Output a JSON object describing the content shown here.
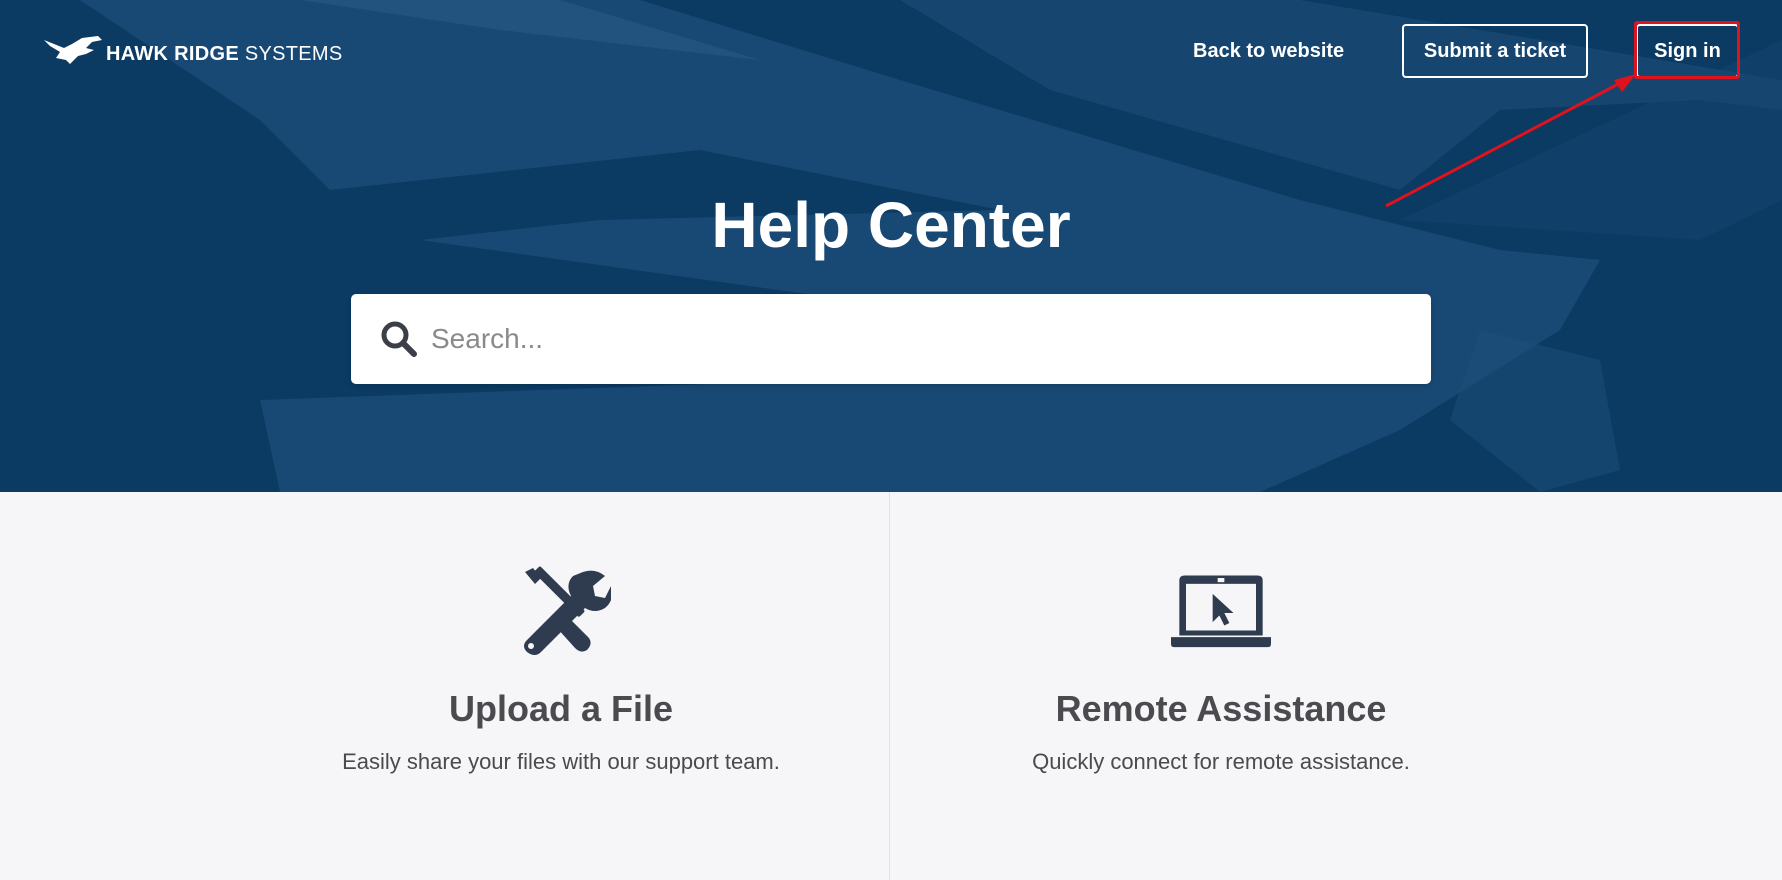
{
  "header": {
    "logo_text_bold": "HAWK RIDGE",
    "logo_text_regular": "SYSTEMS",
    "back_link": "Back to website",
    "submit_ticket": "Submit a ticket",
    "sign_in": "Sign in"
  },
  "hero": {
    "title": "Help Center"
  },
  "search": {
    "placeholder": "Search..."
  },
  "cards": [
    {
      "icon": "tools-icon",
      "title": "Upload a File",
      "description": "Easily share your files with our support team."
    },
    {
      "icon": "laptop-cursor-icon",
      "title": "Remote Assistance",
      "description": "Quickly connect for remote assistance."
    }
  ],
  "colors": {
    "hero_bg": "#0b3a63",
    "annotation_red": "#e0121b",
    "icon_dark": "#2f3b4f",
    "text_gray": "#4a4a4f"
  }
}
